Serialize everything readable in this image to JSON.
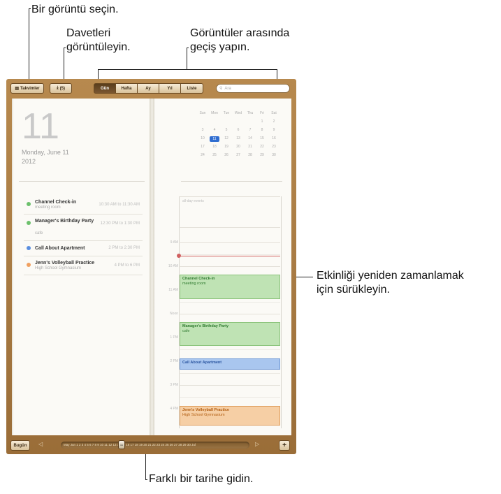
{
  "callouts": {
    "choose_view": "Bir görüntü seçin.",
    "view_invites_line1": "Davetleri",
    "view_invites_line2": "görüntüleyin.",
    "switch_views_line1": "Görüntüler arasında",
    "switch_views_line2": "geçiş yapın.",
    "drag_line1": "Etkinliği yeniden zamanlamak",
    "drag_line2": "için sürükleyin.",
    "goto_date": "Farklı bir tarihe gidin."
  },
  "toolbar": {
    "calendars_label": "Takvimler",
    "inbox_label": "(5)",
    "views": [
      {
        "label": "Gün",
        "active": true
      },
      {
        "label": "Hafta",
        "active": false
      },
      {
        "label": "Ay",
        "active": false
      },
      {
        "label": "Yıl",
        "active": false
      },
      {
        "label": "Liste",
        "active": false
      }
    ],
    "search_placeholder": "Ara"
  },
  "left_page": {
    "day_number": "11",
    "date_line": "Monday, June 11",
    "year": "2012",
    "events": [
      {
        "title": "Channel Check-in",
        "sub": "meeting room",
        "time": "10:30 AM to 11:30 AM",
        "color": "#6cc06c"
      },
      {
        "title": "Manager's Birthday Party",
        "sub": "cafe",
        "time": "12:30 PM to 1:30 PM",
        "color": "#6cc06c"
      },
      {
        "title": "Call About Apartment",
        "sub": "",
        "time": "2 PM to 2:30 PM",
        "color": "#5a8ee0"
      },
      {
        "title": "Jenn's Volleyball Practice",
        "sub": "High School Gymnasium",
        "time": "4 PM to 6 PM",
        "color": "#f0a060"
      }
    ]
  },
  "mini_calendar": {
    "weekdays": [
      "Sun",
      "Mon",
      "Tue",
      "Wed",
      "Thu",
      "Fri",
      "Sat"
    ],
    "weeks": [
      [
        "",
        "",
        "",
        "",
        "",
        "1",
        "2"
      ],
      [
        "3",
        "4",
        "5",
        "6",
        "7",
        "8",
        "9"
      ],
      [
        "10",
        "11",
        "12",
        "13",
        "14",
        "15",
        "16"
      ],
      [
        "17",
        "18",
        "19",
        "20",
        "21",
        "22",
        "23"
      ],
      [
        "24",
        "25",
        "26",
        "27",
        "28",
        "29",
        "30"
      ]
    ],
    "today": "11"
  },
  "schedule": {
    "all_day_label": "all-day events",
    "hours": [
      "9 AM",
      "10 AM",
      "11 AM",
      "Noon",
      "1 PM",
      "2 PM",
      "3 PM",
      "4 PM"
    ],
    "blocks": [
      {
        "title": "Channel Check-in",
        "sub": "meeting room",
        "bg": "#bfe3b4",
        "fg": "#2f7a2f",
        "border": "#8cc47c"
      },
      {
        "title": "Manager's Birthday Party",
        "sub": "cafe",
        "bg": "#bfe3b4",
        "fg": "#2f7a2f",
        "border": "#8cc47c"
      },
      {
        "title": "Call About Apartment",
        "sub": "",
        "bg": "#a9c6ef",
        "fg": "#2a55a0",
        "border": "#6f98d6"
      },
      {
        "title": "Jenn's Volleyball Practice",
        "sub": "High School Gymnasium",
        "bg": "#f6cfa5",
        "fg": "#b25e12",
        "border": "#e0a060"
      }
    ]
  },
  "bottombar": {
    "today_label": "Bugün",
    "timeline_text": "May   Jun 1 2 3 4 5 6 7 8 9 10 11 12 13 14 15 16 17 18 19 20 21 22 23 24 25 26 27 28 29 30   Jul",
    "thumb_label": "11",
    "add_label": "+"
  }
}
